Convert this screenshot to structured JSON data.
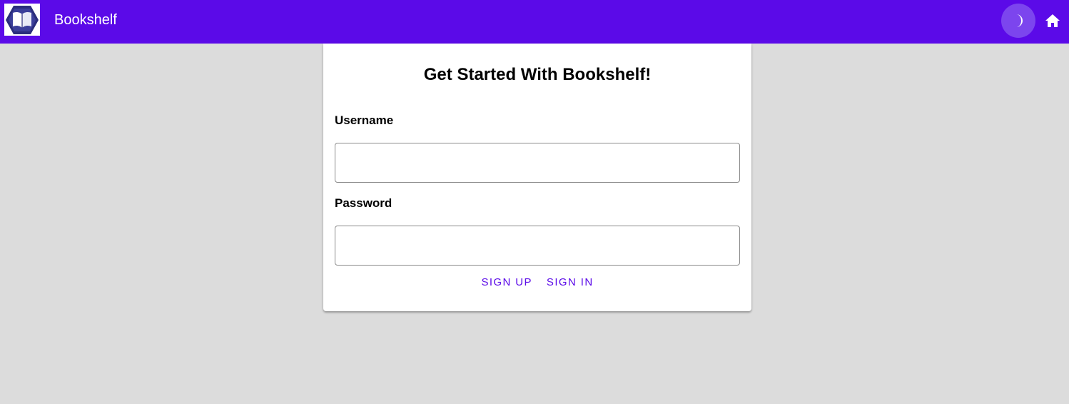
{
  "appbar": {
    "title": "Bookshelf",
    "background_color": "#5b0ae8",
    "logo_icon": "open-book-hexagon-logo",
    "theme_toggle_icon": "half-moon-icon",
    "home_icon": "home-icon"
  },
  "login_card": {
    "title": "Get Started With Bookshelf!",
    "username": {
      "label": "Username",
      "value": "",
      "placeholder": ""
    },
    "password": {
      "label": "Password",
      "value": "",
      "placeholder": ""
    },
    "actions": {
      "sign_up_label": "SIGN UP",
      "sign_in_label": "SIGN IN"
    }
  },
  "page": {
    "background_color": "#dcdcdc"
  }
}
